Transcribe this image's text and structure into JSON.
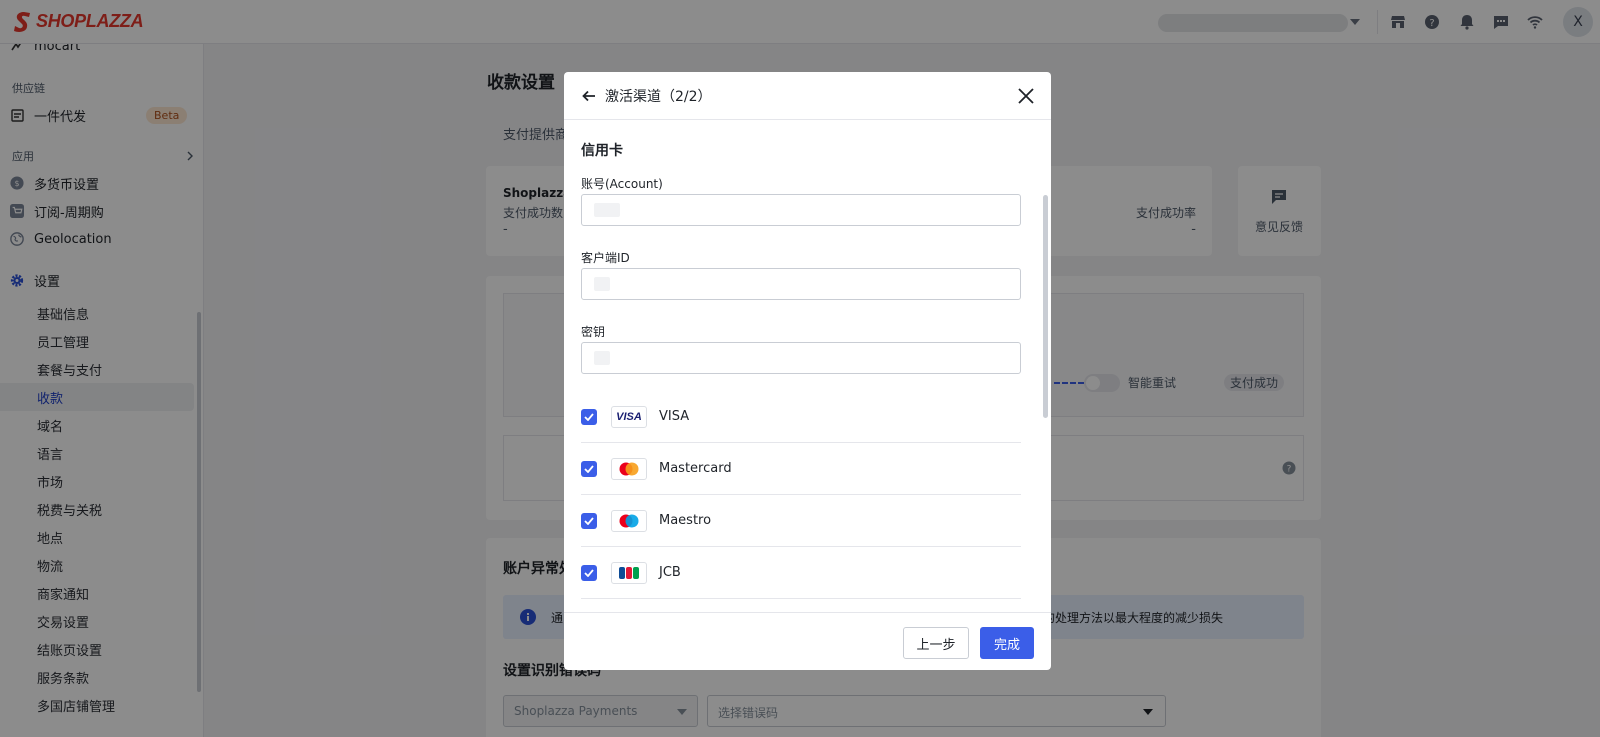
{
  "app": {
    "brand": "SHOPLAZZA"
  },
  "sidebar": {
    "partial_top": "mocart",
    "group_supply": "供应链",
    "dropship": "一件代发",
    "beta": "Beta",
    "group_apps": "应用",
    "apps": [
      "多货币设置",
      "订阅-周期购",
      "Geolocation"
    ],
    "settings": "设置",
    "sub_items": [
      "基础信息",
      "员工管理",
      "套餐与支付",
      "收款",
      "域名",
      "语言",
      "市场",
      "税费与关税",
      "地点",
      "物流",
      "商家通知",
      "交易设置",
      "结账页设置",
      "服务条款",
      "多国店铺管理"
    ],
    "active_item": "收款"
  },
  "main": {
    "title": "收款设置",
    "tab": "支付提供商",
    "stat_name": "Shoplazza",
    "stat_label": "支付成功数",
    "stat_value": "-",
    "rate_label": "支付成功率",
    "rate_value": "-",
    "feedback": "意见反馈",
    "smart_retry": "智能重试",
    "pay_success": "支付成功",
    "section_abnormal": "账户异常处",
    "notice_left": "通",
    "notice_right": "的处理方法以最大程度的减少损失",
    "section_error": "设置识别错误码",
    "select_provider": "Shoplazza Payments",
    "select_error_placeholder": "选择错误码"
  },
  "modal": {
    "title": "激活渠道（2/2）",
    "section": "信用卡",
    "fields": [
      {
        "label": "账号(Account)",
        "value": ""
      },
      {
        "label": "客户端ID",
        "value": ""
      },
      {
        "label": "密钥",
        "value": ""
      }
    ],
    "cards": [
      {
        "name": "VISA",
        "checked": true
      },
      {
        "name": "Mastercard",
        "checked": true
      },
      {
        "name": "Maestro",
        "checked": true
      },
      {
        "name": "JCB",
        "checked": true
      }
    ],
    "prev_button": "上一步",
    "done_button": "完成"
  },
  "colors": {
    "accent": "#3b5ee8",
    "brand": "#e5372c"
  }
}
